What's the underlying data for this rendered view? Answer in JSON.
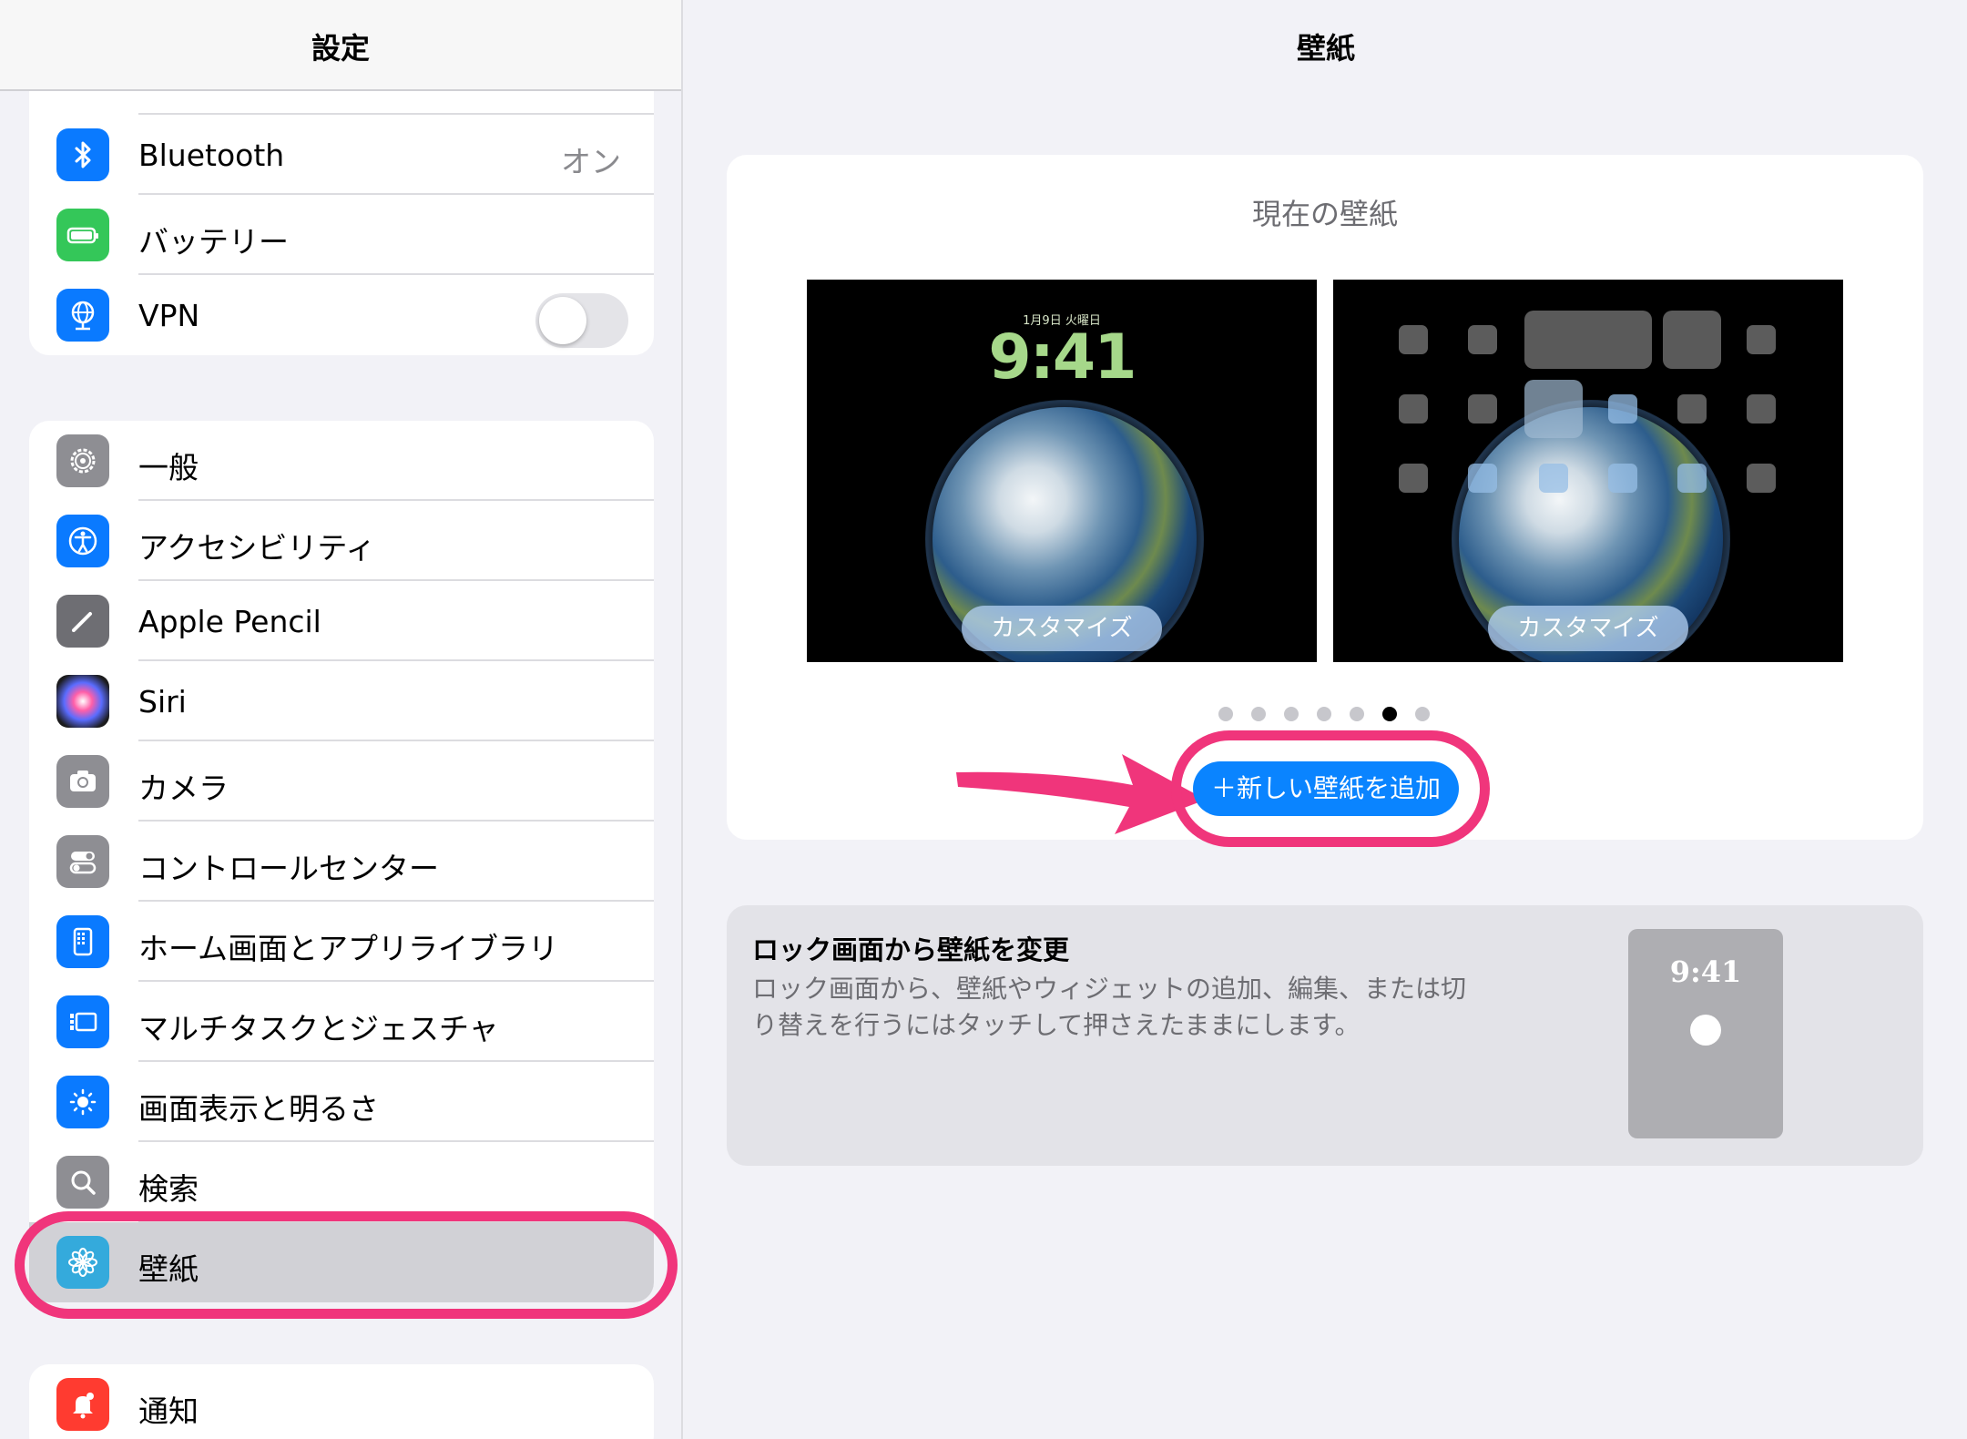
{
  "sidebar": {
    "title": "設定",
    "group1": [
      {
        "label": "Bluetooth",
        "value": "オン",
        "icon": "bluetooth-icon",
        "color": "#0a7aff"
      },
      {
        "label": "バッテリー",
        "icon": "battery-icon",
        "color": "#34c759"
      },
      {
        "label": "VPN",
        "icon": "vpn-globe-icon",
        "color": "#0a7aff",
        "toggle": false
      }
    ],
    "group2": [
      {
        "label": "一般",
        "icon": "gear-icon",
        "color": "#8e8e93"
      },
      {
        "label": "アクセシビリティ",
        "icon": "accessibility-icon",
        "color": "#0a7aff"
      },
      {
        "label": "Apple Pencil",
        "icon": "pencil-icon",
        "color": "#6e6e73"
      },
      {
        "label": "Siri",
        "icon": "siri-icon",
        "color": "#1c1c1e"
      },
      {
        "label": "カメラ",
        "icon": "camera-icon",
        "color": "#8e8e93"
      },
      {
        "label": "コントロールセンター",
        "icon": "control-center-icon",
        "color": "#8e8e93"
      },
      {
        "label": "ホーム画面とアプリライブラリ",
        "icon": "home-screen-icon",
        "color": "#0a7aff"
      },
      {
        "label": "マルチタスクとジェスチャ",
        "icon": "multitasking-icon",
        "color": "#0a7aff"
      },
      {
        "label": "画面表示と明るさ",
        "icon": "brightness-icon",
        "color": "#0a7aff"
      },
      {
        "label": "検索",
        "icon": "search-icon",
        "color": "#8e8e93"
      },
      {
        "label": "壁紙",
        "icon": "wallpaper-flower-icon",
        "color": "#34aadc",
        "selected": true
      }
    ],
    "group3": [
      {
        "label": "通知",
        "icon": "notification-icon",
        "color": "#ff3b30"
      }
    ]
  },
  "main": {
    "title": "壁紙",
    "current_heading": "現在の壁紙",
    "lock_preview": {
      "date": "1月9日 火曜日",
      "time": "9:41",
      "customize_label": "カスタマイズ"
    },
    "home_preview": {
      "customize_label": "カスタマイズ"
    },
    "page_dots": {
      "count": 7,
      "active_index": 5
    },
    "add_button_label": "＋新しい壁紙を追加",
    "lock_card": {
      "title": "ロック画面から壁紙を変更",
      "description": "ロック画面から、壁紙やウィジェットの追加、編集、または切り替えを行うにはタッチして押さえたままにします。",
      "mini_time": "9:41"
    }
  },
  "colors": {
    "accent_blue": "#0a84ff",
    "annotation_pink": "#f0357b",
    "selected_row": "#d1d1d6"
  }
}
